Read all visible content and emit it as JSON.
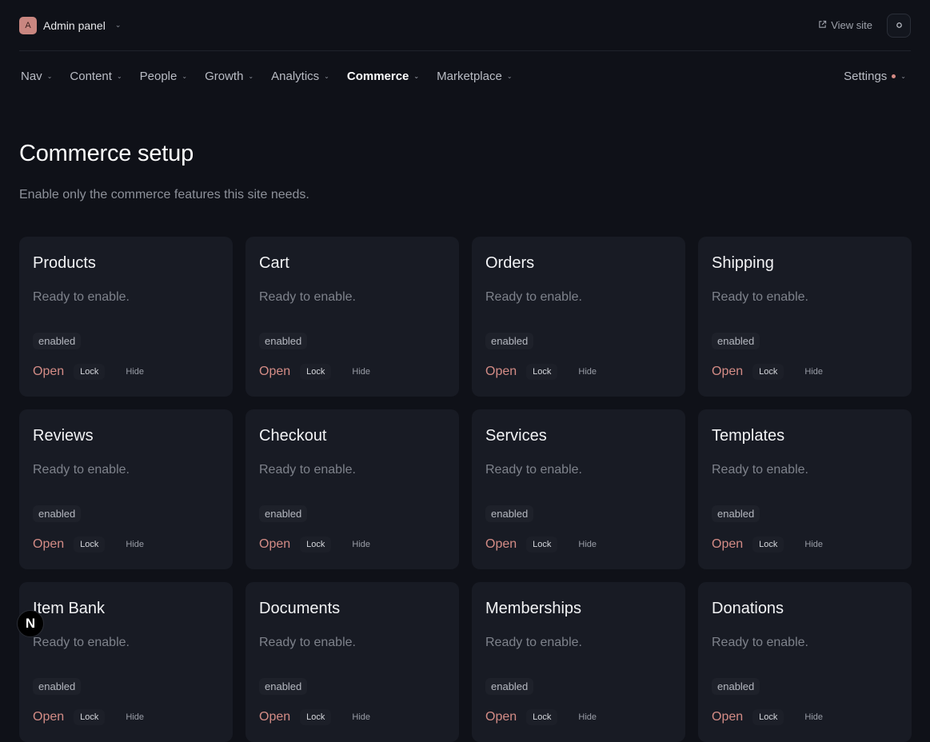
{
  "header": {
    "avatar_letter": "A",
    "brand_label": "Admin panel",
    "view_site_label": "View site"
  },
  "nav": {
    "items": [
      {
        "label": "Nav",
        "active": false
      },
      {
        "label": "Content",
        "active": false
      },
      {
        "label": "People",
        "active": false
      },
      {
        "label": "Growth",
        "active": false
      },
      {
        "label": "Analytics",
        "active": false
      },
      {
        "label": "Commerce",
        "active": true
      },
      {
        "label": "Marketplace",
        "active": false
      }
    ],
    "settings_label": "Settings"
  },
  "page": {
    "title": "Commerce setup",
    "subtitle": "Enable only the commerce features this site needs."
  },
  "cards": [
    {
      "title": "Products",
      "desc": "Ready to enable.",
      "badge": "enabled",
      "open": "Open",
      "lock": "Lock",
      "hide": "Hide"
    },
    {
      "title": "Cart",
      "desc": "Ready to enable.",
      "badge": "enabled",
      "open": "Open",
      "lock": "Lock",
      "hide": "Hide"
    },
    {
      "title": "Orders",
      "desc": "Ready to enable.",
      "badge": "enabled",
      "open": "Open",
      "lock": "Lock",
      "hide": "Hide"
    },
    {
      "title": "Shipping",
      "desc": "Ready to enable.",
      "badge": "enabled",
      "open": "Open",
      "lock": "Lock",
      "hide": "Hide"
    },
    {
      "title": "Reviews",
      "desc": "Ready to enable.",
      "badge": "enabled",
      "open": "Open",
      "lock": "Lock",
      "hide": "Hide"
    },
    {
      "title": "Checkout",
      "desc": "Ready to enable.",
      "badge": "enabled",
      "open": "Open",
      "lock": "Lock",
      "hide": "Hide"
    },
    {
      "title": "Services",
      "desc": "Ready to enable.",
      "badge": "enabled",
      "open": "Open",
      "lock": "Lock",
      "hide": "Hide"
    },
    {
      "title": "Templates",
      "desc": "Ready to enable.",
      "badge": "enabled",
      "open": "Open",
      "lock": "Lock",
      "hide": "Hide"
    },
    {
      "title": "Item Bank",
      "desc": "Ready to enable.",
      "badge": "enabled",
      "open": "Open",
      "lock": "Lock",
      "hide": "Hide"
    },
    {
      "title": "Documents",
      "desc": "Ready to enable.",
      "badge": "enabled",
      "open": "Open",
      "lock": "Lock",
      "hide": "Hide"
    },
    {
      "title": "Memberships",
      "desc": "Ready to enable.",
      "badge": "enabled",
      "open": "Open",
      "lock": "Lock",
      "hide": "Hide"
    },
    {
      "title": "Donations",
      "desc": "Ready to enable.",
      "badge": "enabled",
      "open": "Open",
      "lock": "Lock",
      "hide": "Hide"
    }
  ],
  "floating_badge": "N",
  "colors": {
    "background": "#0f1118",
    "card": "#181b24",
    "accent": "#d48c86"
  }
}
